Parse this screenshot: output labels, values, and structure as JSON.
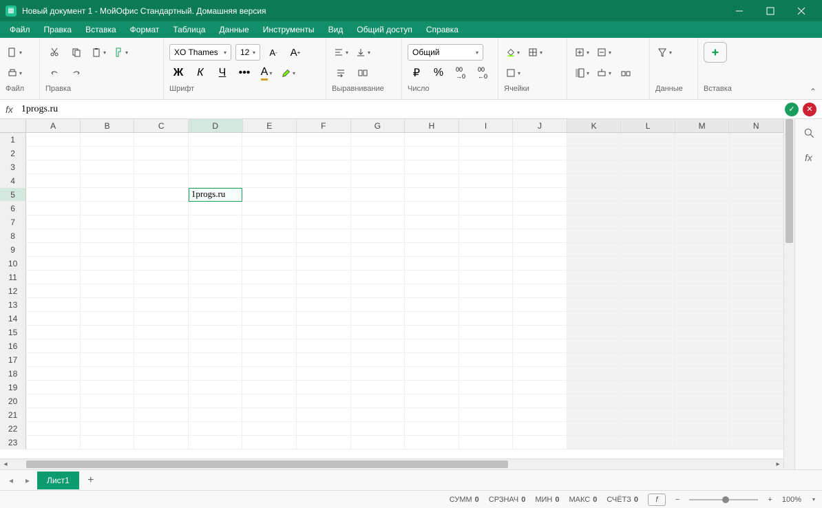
{
  "title": "Новый документ 1 - МойОфис Стандартный. Домашняя версия",
  "menu": {
    "items": [
      "Файл",
      "Правка",
      "Вставка",
      "Формат",
      "Таблица",
      "Данные",
      "Инструменты",
      "Вид",
      "Общий доступ",
      "Справка"
    ]
  },
  "toolbar": {
    "groups": {
      "file": "Файл",
      "edit": "Правка",
      "font": "Шрифт",
      "align": "Выравнивание",
      "number": "Число",
      "cells": "Ячейки",
      "data": "Данные",
      "insert": "Вставка"
    },
    "font_name": "XO Thames",
    "font_size": "12",
    "number_format": "Общий"
  },
  "formula": {
    "fx": "fx",
    "value": "1progs.ru"
  },
  "grid": {
    "columns": [
      "A",
      "B",
      "C",
      "D",
      "E",
      "F",
      "G",
      "H",
      "I",
      "J",
      "K",
      "L",
      "M",
      "N"
    ],
    "rows": 23,
    "active_col": "D",
    "active_row": 5,
    "cells": {
      "D5": "1progs.ru"
    },
    "inactive_from_col": 10
  },
  "tabs": {
    "sheet1": "Лист1"
  },
  "status": {
    "sum_label": "СУММ",
    "sum_val": "0",
    "avg_label": "СРЗНАЧ",
    "avg_val": "0",
    "min_label": "МИН",
    "min_val": "0",
    "max_label": "МАКС",
    "max_val": "0",
    "count_label": "СЧЁТЗ",
    "count_val": "0",
    "zoom": "100%"
  }
}
